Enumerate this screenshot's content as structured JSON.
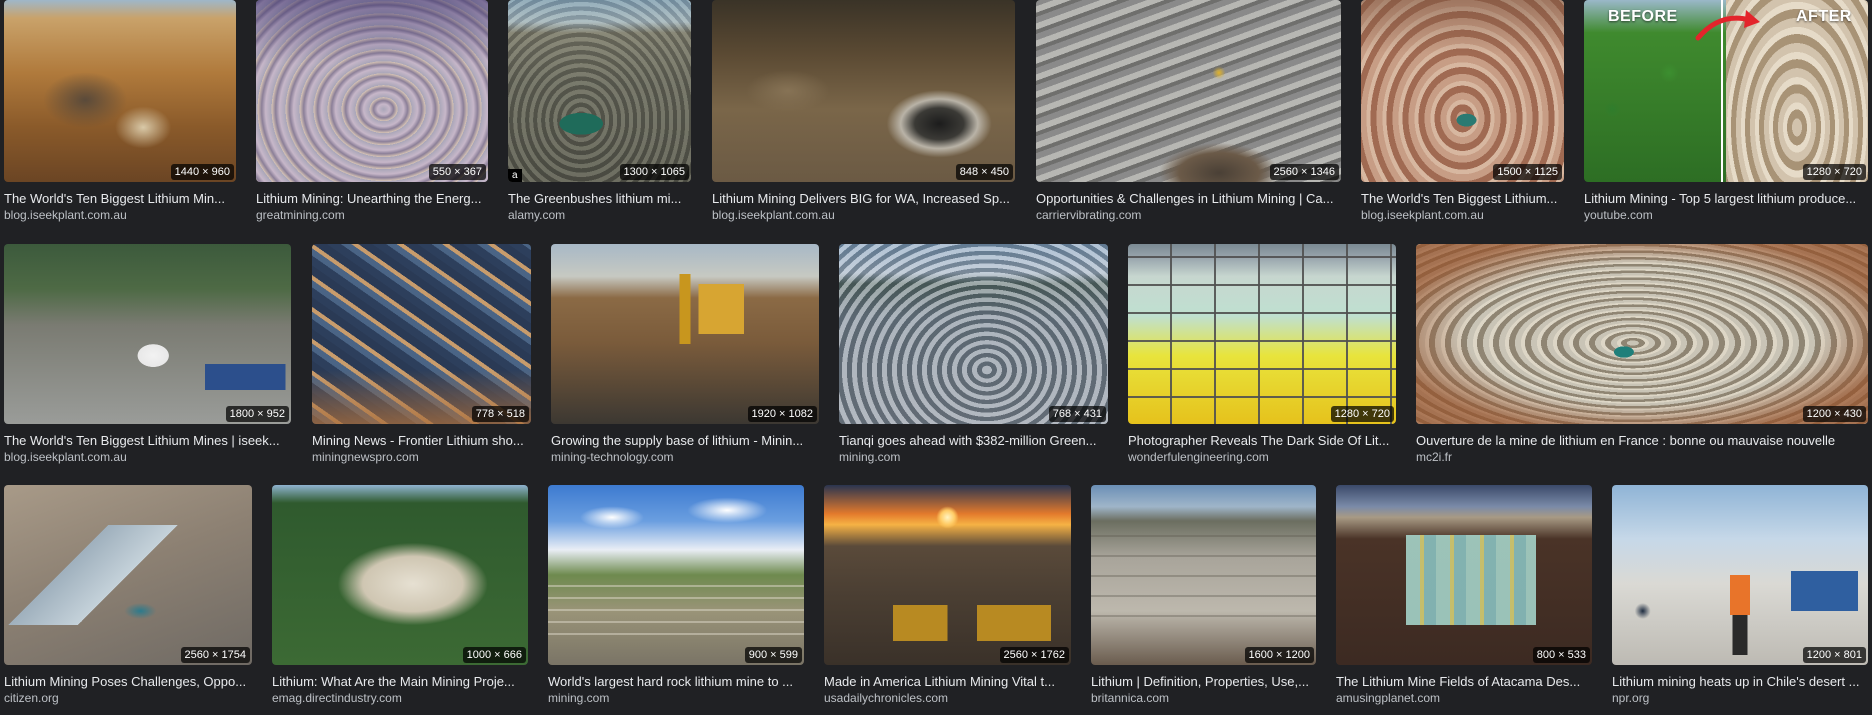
{
  "results": [
    [
      {
        "dims": "1440 × 960",
        "title": "The World's Ten Biggest Lithium Min...",
        "source": "blog.iseekplant.com.au",
        "icon": "mine-site-thumbnail"
      },
      {
        "dims": "550 × 367",
        "title": "Lithium Mining: Unearthing the Energ...",
        "source": "greatmining.com",
        "icon": "open-pit-thumbnail"
      },
      {
        "dims": "1300 × 1065",
        "title": "The Greenbushes lithium mi...",
        "source": "alamy.com",
        "icon": "pit-lake-thumbnail",
        "watermark": "a"
      },
      {
        "dims": "848 × 450",
        "title": "Lithium Mining Delivers BIG for WA, Increased Sp...",
        "source": "blog.iseekplant.com.au",
        "icon": "aerial-pit-thumbnail"
      },
      {
        "dims": "2560 × 1346",
        "title": "Opportunities & Challenges in Lithium Mining | Ca...",
        "source": "carriervibrating.com",
        "icon": "quarry-thumbnail"
      },
      {
        "dims": "1500 × 1125",
        "title": "The World's Ten Biggest Lithium...",
        "source": "blog.iseekplant.com.au",
        "icon": "red-pit-thumbnail"
      },
      {
        "dims": "1280 × 720",
        "title": "Lithium Mining - Top 5 largest lithium produce...",
        "source": "youtube.com",
        "icon": "before-after-thumbnail",
        "before": "BEFORE",
        "after": "AFTER"
      }
    ],
    [
      {
        "dims": "1800 × 952",
        "title": "The World's Ten Biggest Lithium Mines | iseek...",
        "source": "blog.iseekplant.com.au",
        "icon": "processing-plant-thumbnail"
      },
      {
        "dims": "778 × 518",
        "title": "Mining News - Frontier Lithium sho...",
        "source": "miningnewspro.com",
        "icon": "terraced-pit-thumbnail"
      },
      {
        "dims": "1920 × 1082",
        "title": "Growing the supply base of lithium - Minin...",
        "source": "mining-technology.com",
        "icon": "excavator-thumbnail"
      },
      {
        "dims": "768 × 431",
        "title": "Tianqi goes ahead with $382-million Green...",
        "source": "mining.com",
        "icon": "valley-pit-thumbnail"
      },
      {
        "dims": "1280 × 720",
        "title": "Photographer Reveals The Dark Side Of Lit...",
        "source": "wonderfulengineering.com",
        "icon": "evaporation-ponds-thumbnail"
      },
      {
        "dims": "1200 × 430",
        "title": "Ouverture de la mine de lithium en France : bonne ou mauvaise nouvelle",
        "source": "mc2i.fr",
        "icon": "wide-pit-thumbnail"
      }
    ],
    [
      {
        "dims": "2560 × 1754",
        "title": "Lithium Mining Poses Challenges, Oppo...",
        "source": "citizen.org",
        "icon": "desert-ponds-thumbnail"
      },
      {
        "dims": "1000 × 666",
        "title": "Lithium: What Are the Main Mining Proje...",
        "source": "emag.directindustry.com",
        "icon": "forest-quarry-thumbnail"
      },
      {
        "dims": "900 × 599",
        "title": "World's largest hard rock lithium mine to ...",
        "source": "mining.com",
        "icon": "sky-quarry-thumbnail"
      },
      {
        "dims": "2560 × 1762",
        "title": "Made in America Lithium Mining Vital t...",
        "source": "usadailychronicles.com",
        "icon": "sunset-trucks-thumbnail"
      },
      {
        "dims": "1600 × 1200",
        "title": "Lithium | Definition, Properties, Use,...",
        "source": "britannica.com",
        "icon": "flat-quarry-thumbnail"
      },
      {
        "dims": "800 × 533",
        "title": "The Lithium Mine Fields of Atacama Des...",
        "source": "amusingplanet.com",
        "icon": "atacama-ponds-thumbnail"
      },
      {
        "dims": "1200 × 801",
        "title": "Lithium mining heats up in Chile's desert ...",
        "source": "npr.org",
        "icon": "worker-thumbnail"
      }
    ]
  ],
  "colors": {
    "background": "#202124",
    "title": "#e8eaed",
    "source": "#bdc1c6",
    "arrow": "#e3242b"
  }
}
